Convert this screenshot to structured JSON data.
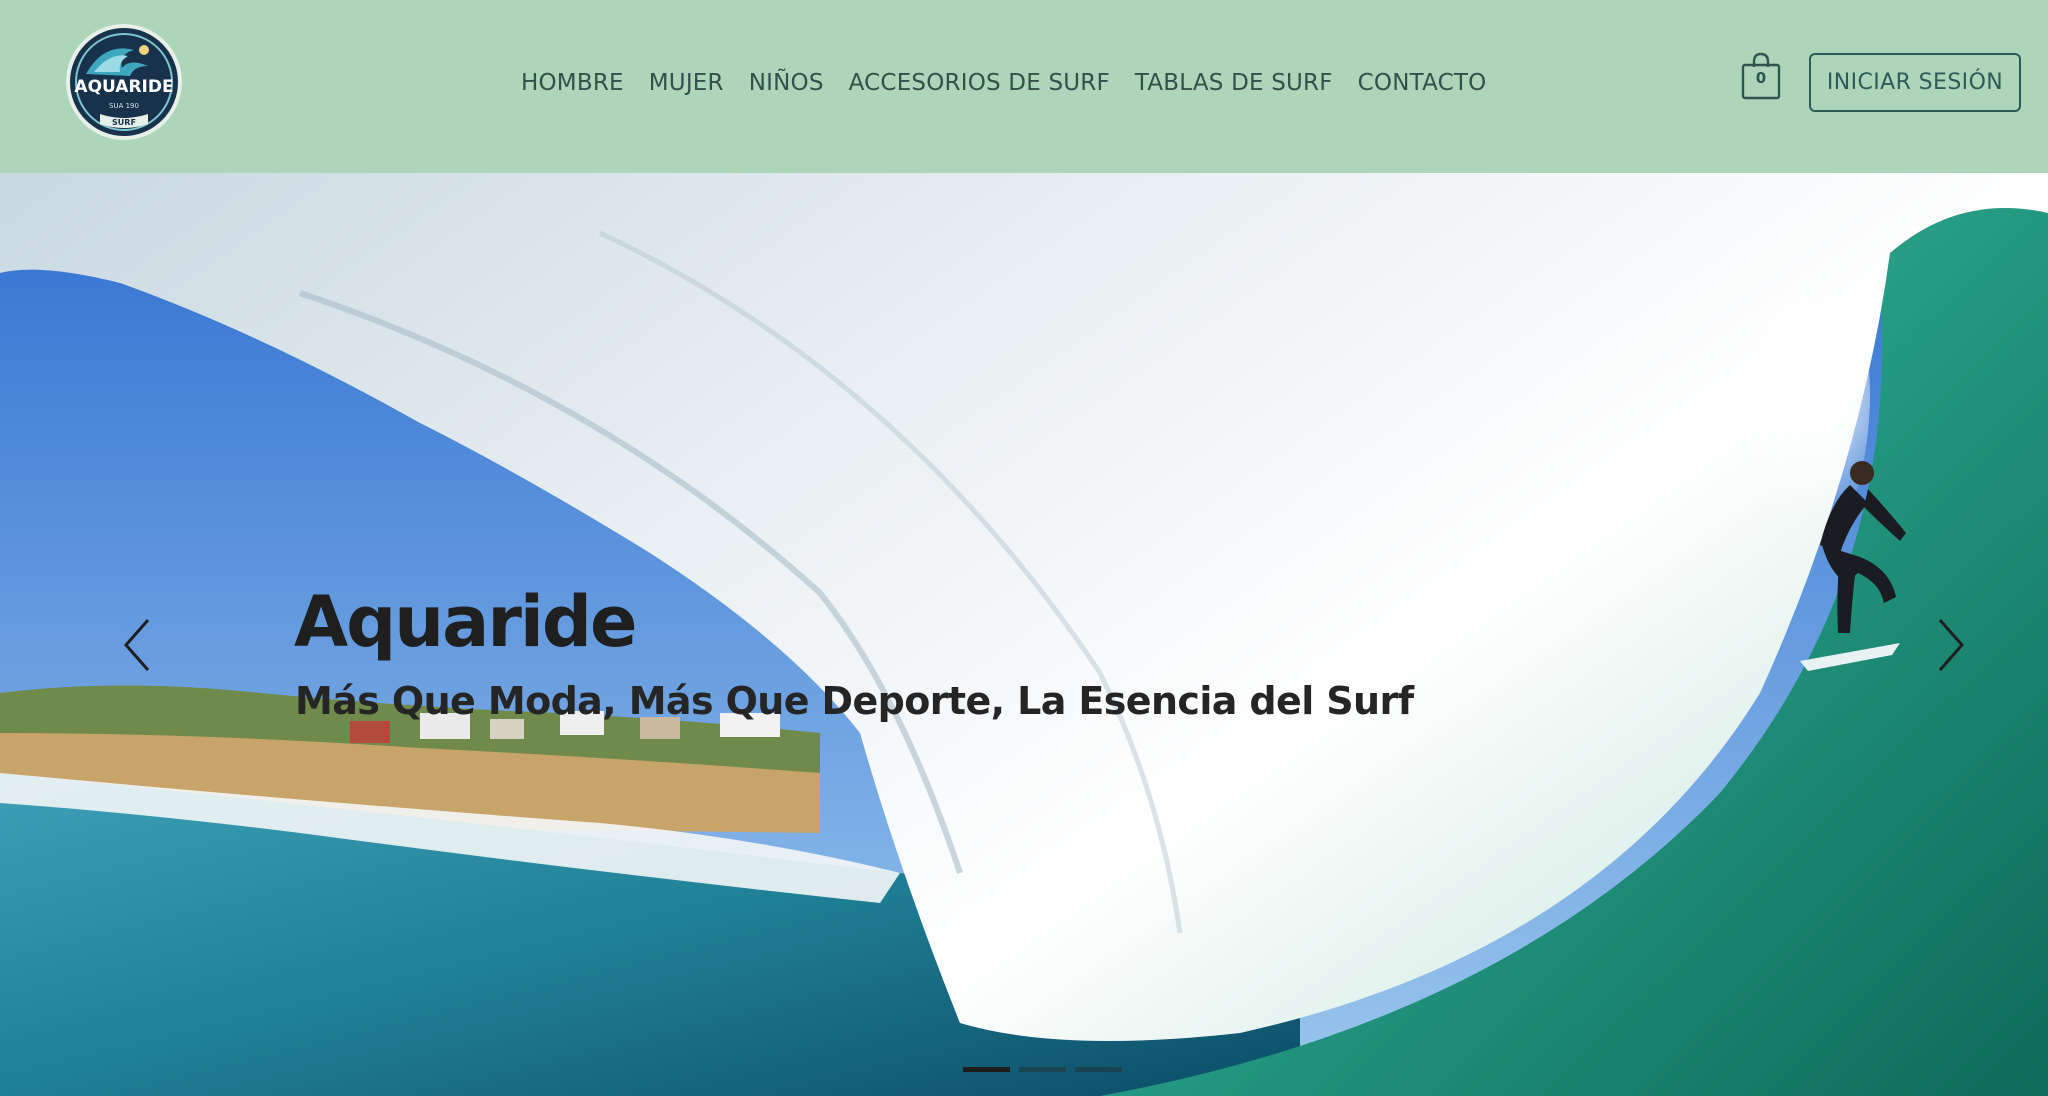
{
  "brand": {
    "name": "AQUARIDE",
    "tagline_small": "SUA 190",
    "sub": "SURF"
  },
  "nav": {
    "items": [
      {
        "label": "HOMBRE"
      },
      {
        "label": "MUJER"
      },
      {
        "label": "NIÑOS"
      },
      {
        "label": "ACCESORIOS DE SURF"
      },
      {
        "label": "TABLAS DE SURF"
      },
      {
        "label": "CONTACTO"
      }
    ]
  },
  "cart": {
    "count": "0",
    "icon": "shopping-bag-icon"
  },
  "login": {
    "label": "INICIAR SESIÓN"
  },
  "hero": {
    "title": "Aquaride",
    "subtitle": "Más Que Moda, Más Que Deporte, La Esencia del Surf",
    "prev_icon": "chevron-left-icon",
    "next_icon": "chevron-right-icon",
    "slide_count": 3,
    "active_slide": 1
  },
  "colors": {
    "header_bg": "#acd5b9",
    "nav_text": "#33504a",
    "button_border": "#2e5a58",
    "hero_text": "#1f1f1f"
  }
}
